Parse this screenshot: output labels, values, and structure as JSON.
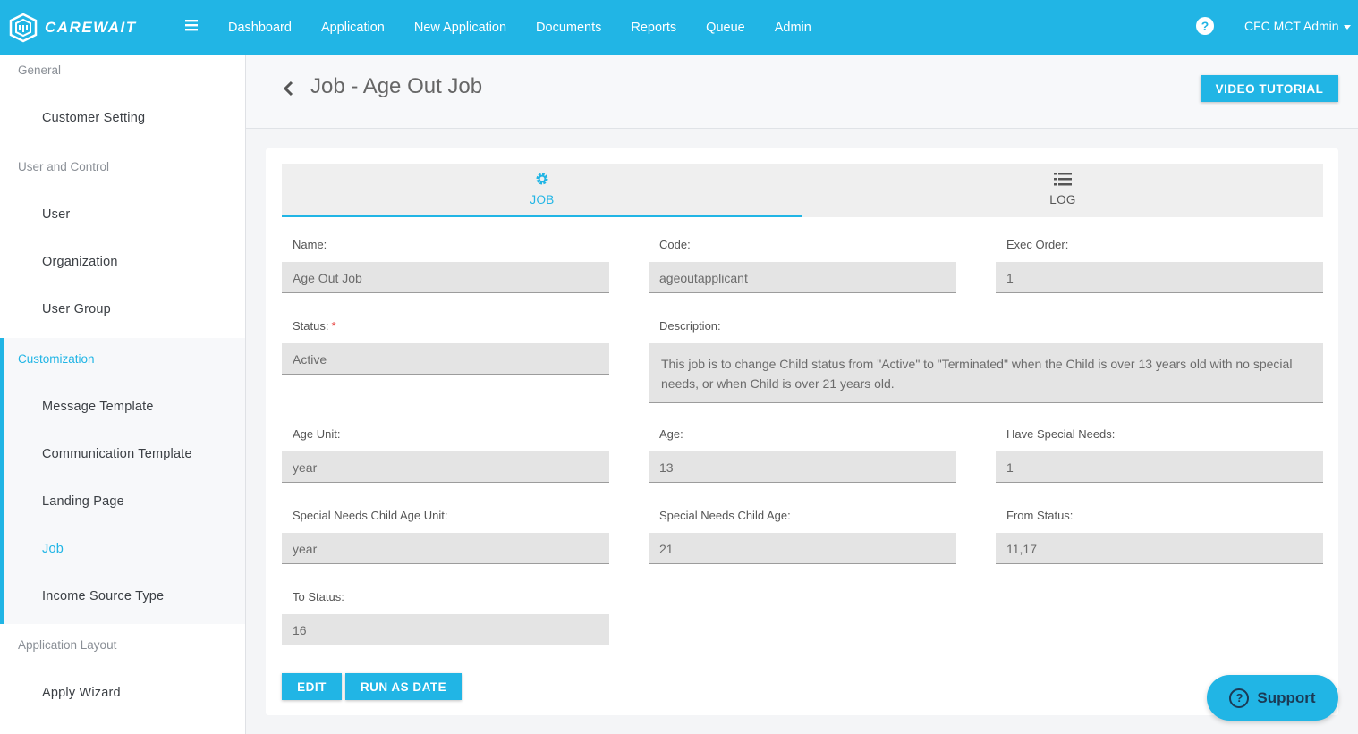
{
  "app": {
    "logo_text": "CAREWAIT",
    "nav": [
      "Dashboard",
      "Application",
      "New Application",
      "Documents",
      "Reports",
      "Queue",
      "Admin"
    ],
    "help_icon": "?",
    "user": "CFC MCT Admin"
  },
  "sidebar": {
    "sections": [
      {
        "heading": "General",
        "items": [
          "Customer Setting"
        ]
      },
      {
        "heading": "User and Control",
        "items": [
          "User",
          "Organization",
          "User Group"
        ]
      },
      {
        "heading": "Customization",
        "items": [
          "Message Template",
          "Communication Template",
          "Landing Page",
          "Job",
          "Income Source Type"
        ]
      },
      {
        "heading": "Application Layout",
        "items": [
          "Apply Wizard"
        ]
      }
    ],
    "active_section": "Customization",
    "active_item": "Job"
  },
  "page": {
    "title": "Job - Age Out Job",
    "video_button": "VIDEO TUTORIAL"
  },
  "tabs": {
    "job": "JOB",
    "log": "LOG",
    "active": "JOB"
  },
  "fields": {
    "name": {
      "label": "Name:",
      "value": "Age Out Job"
    },
    "code": {
      "label": "Code:",
      "value": "ageoutapplicant"
    },
    "exec_order": {
      "label": "Exec Order:",
      "value": "1"
    },
    "status": {
      "label": "Status:",
      "required": "*",
      "value": "Active"
    },
    "description": {
      "label": "Description:",
      "value": "This job is to change Child status from \"Active\" to \"Terminated\" when the Child is over 13 years old with no special needs, or when Child is over 21 years old."
    },
    "age_unit": {
      "label": "Age Unit:",
      "value": "year"
    },
    "age": {
      "label": "Age:",
      "value": "13"
    },
    "have_special_needs": {
      "label": "Have Special Needs:",
      "value": "1"
    },
    "special_needs_age_unit": {
      "label": "Special Needs Child Age Unit:",
      "value": "year"
    },
    "special_needs_age": {
      "label": "Special Needs Child Age:",
      "value": "21"
    },
    "from_status": {
      "label": "From Status:",
      "value": "11,17"
    },
    "to_status": {
      "label": "To Status:",
      "value": "16"
    }
  },
  "actions": {
    "edit": "EDIT",
    "run_as_date": "RUN AS DATE"
  },
  "support": {
    "label": "Support",
    "icon": "?"
  },
  "colors": {
    "primary": "#21b5e5",
    "field_bg": "#e4e4e4",
    "required": "#e53935"
  }
}
